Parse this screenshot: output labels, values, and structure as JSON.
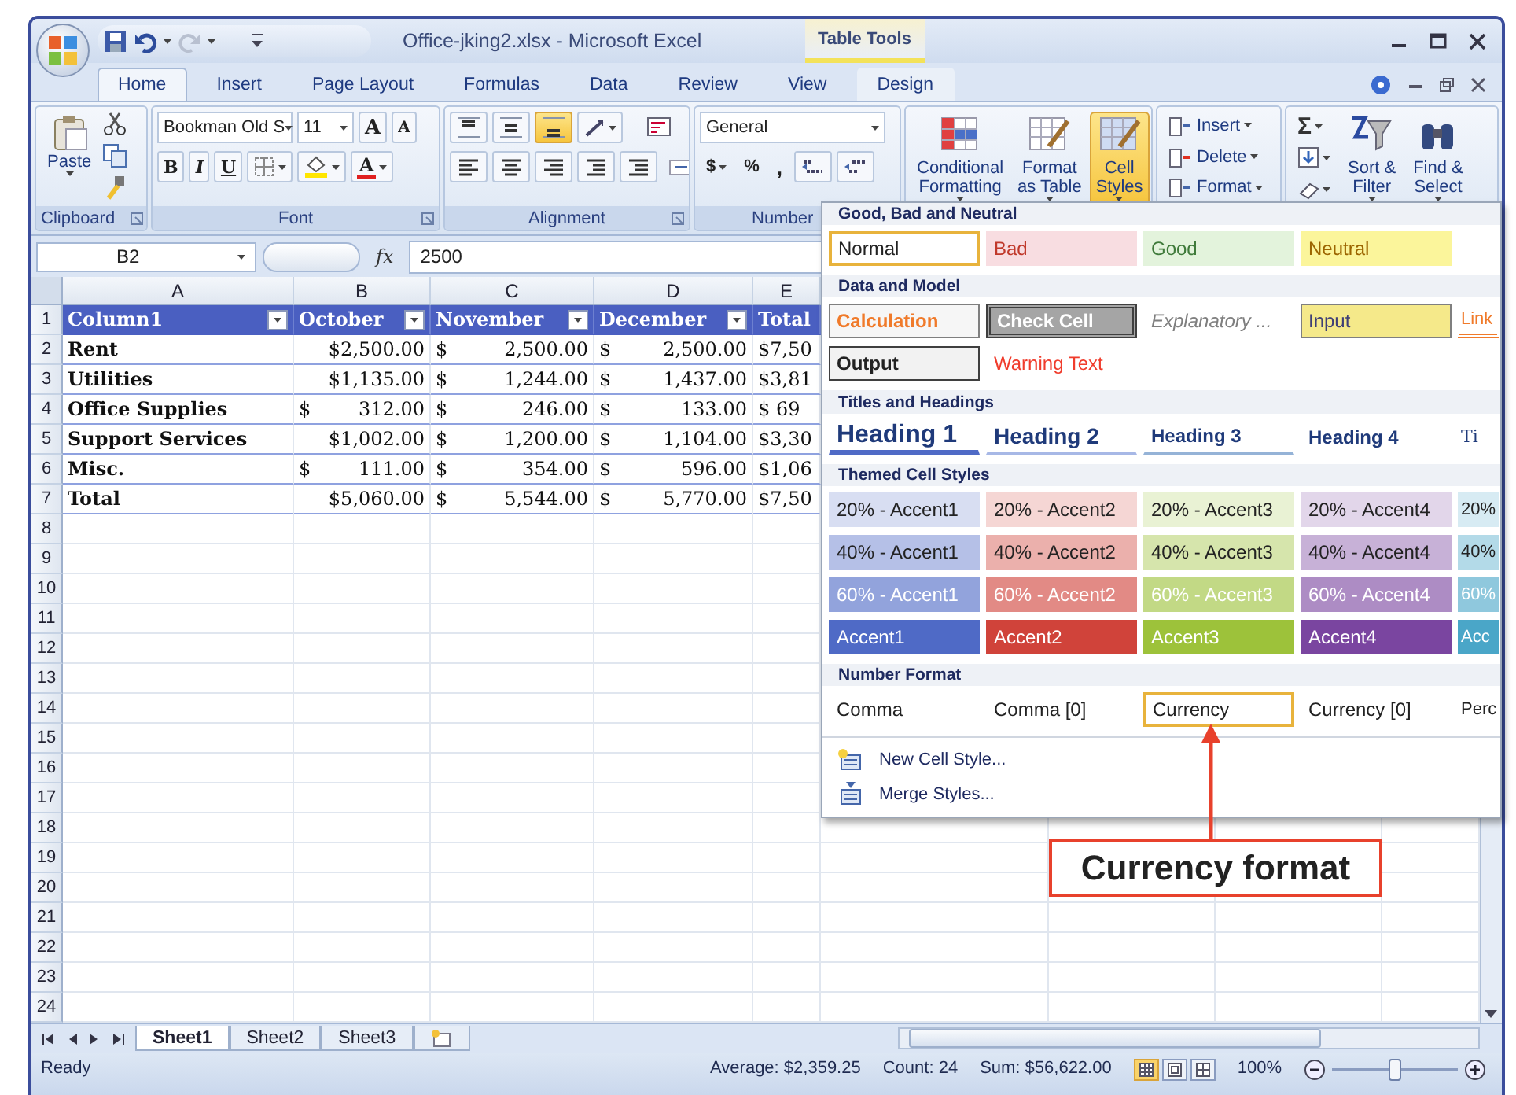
{
  "window": {
    "title": "Office-jking2.xlsx - Microsoft Excel",
    "contextual_title": "Table Tools"
  },
  "tabs": [
    {
      "label": "Home",
      "selected": true,
      "kind": "standard"
    },
    {
      "label": "Insert",
      "selected": false,
      "kind": "standard"
    },
    {
      "label": "Page Layout",
      "selected": false,
      "kind": "standard"
    },
    {
      "label": "Formulas",
      "selected": false,
      "kind": "standard"
    },
    {
      "label": "Data",
      "selected": false,
      "kind": "standard"
    },
    {
      "label": "Review",
      "selected": false,
      "kind": "standard"
    },
    {
      "label": "View",
      "selected": false,
      "kind": "standard"
    },
    {
      "label": "Design",
      "selected": false,
      "kind": "contextual"
    }
  ],
  "ribbon": {
    "clipboard": {
      "paste": "Paste",
      "label": "Clipboard"
    },
    "font": {
      "name": "Bookman Old S",
      "size": "11",
      "grow": "A",
      "shrink": "A",
      "bold": "B",
      "italic": "I",
      "underline": "U",
      "color_letter": "A",
      "label": "Font"
    },
    "alignment": {
      "vertical": [
        {
          "selected": false
        },
        {
          "selected": false
        },
        {
          "selected": true
        }
      ],
      "label": "Alignment"
    },
    "number": {
      "format": "General",
      "currency": "$",
      "percent": "%",
      "comma": ",",
      "label": "Number"
    },
    "styles": [
      {
        "lines": [
          "Conditional",
          "Formatting"
        ],
        "selected": false
      },
      {
        "lines": [
          "Format",
          "as Table"
        ],
        "selected": false
      },
      {
        "lines": [
          "Cell",
          "Styles"
        ],
        "selected": true
      }
    ],
    "cells": [
      "Insert",
      "Delete",
      "Format"
    ],
    "editing": {
      "sum": "Σ",
      "sort": [
        "Sort &",
        "Filter"
      ],
      "find": [
        "Find &",
        "Select"
      ]
    }
  },
  "formula_bar": {
    "name_box": "B2",
    "function": "fx",
    "value": "2500"
  },
  "sheet": {
    "columns": [
      "A",
      "B",
      "C",
      "D",
      "E"
    ],
    "rows": [
      {
        "number": "1",
        "kind": "header",
        "cells": [
          {
            "text": "Column1",
            "filter": true
          },
          {
            "text": "October",
            "filter": true
          },
          {
            "text": "November",
            "filter": true
          },
          {
            "text": "December",
            "filter": true
          },
          {
            "text": "Total",
            "filter": false
          }
        ]
      },
      {
        "number": "2",
        "kind": "data",
        "cells": [
          {
            "text": "Rent"
          },
          {
            "text": "$2,500.00"
          },
          {
            "symbol": "$",
            "amount": "2,500.00"
          },
          {
            "symbol": "$",
            "amount": "2,500.00"
          },
          {
            "text": "$7,50"
          }
        ]
      },
      {
        "number": "3",
        "kind": "data",
        "cells": [
          {
            "text": "Utilities"
          },
          {
            "text": "$1,135.00"
          },
          {
            "symbol": "$",
            "amount": "1,244.00"
          },
          {
            "symbol": "$",
            "amount": "1,437.00"
          },
          {
            "text": "$3,81"
          }
        ]
      },
      {
        "number": "4",
        "kind": "data",
        "cells": [
          {
            "text": "Office Supplies"
          },
          {
            "symbol": "$",
            "amount": "312.00"
          },
          {
            "symbol": "$",
            "amount": "246.00"
          },
          {
            "symbol": "$",
            "amount": "133.00"
          },
          {
            "text": "$ 69"
          }
        ]
      },
      {
        "number": "5",
        "kind": "data",
        "cells": [
          {
            "text": "Support Services"
          },
          {
            "text": "$1,002.00"
          },
          {
            "symbol": "$",
            "amount": "1,200.00"
          },
          {
            "symbol": "$",
            "amount": "1,104.00"
          },
          {
            "text": "$3,30"
          }
        ]
      },
      {
        "number": "6",
        "kind": "data",
        "cells": [
          {
            "text": "Misc."
          },
          {
            "symbol": "$",
            "amount": "111.00"
          },
          {
            "symbol": "$",
            "amount": "354.00"
          },
          {
            "symbol": "$",
            "amount": "596.00"
          },
          {
            "text": "$1,06"
          }
        ]
      },
      {
        "number": "7",
        "kind": "data",
        "cells": [
          {
            "text": "Total"
          },
          {
            "text": "$5,060.00"
          },
          {
            "symbol": "$",
            "amount": "5,544.00"
          },
          {
            "symbol": "$",
            "amount": "5,770.00"
          },
          {
            "text": "$7,50"
          }
        ]
      },
      {
        "number": "8"
      },
      {
        "number": "9"
      },
      {
        "number": "10"
      },
      {
        "number": "11"
      },
      {
        "number": "12"
      },
      {
        "number": "13"
      },
      {
        "number": "14"
      },
      {
        "number": "15"
      },
      {
        "number": "16"
      },
      {
        "number": "17"
      },
      {
        "number": "18"
      },
      {
        "number": "19"
      },
      {
        "number": "20"
      },
      {
        "number": "21"
      },
      {
        "number": "22"
      },
      {
        "number": "23"
      },
      {
        "number": "24"
      }
    ]
  },
  "gallery": {
    "sections": [
      {
        "title": "Good, Bad and Neutral",
        "items": [
          {
            "label": "Normal",
            "kind": "normal",
            "selected": true
          },
          {
            "label": "Bad",
            "kind": "bad",
            "selected": false
          },
          {
            "label": "Good",
            "kind": "good",
            "selected": false
          },
          {
            "label": "Neutral",
            "kind": "neutral",
            "selected": false
          }
        ]
      },
      {
        "title": "Data and Model",
        "items": [
          {
            "label": "Calculation",
            "kind": "calculation",
            "selected": false
          },
          {
            "label": "Check Cell",
            "kind": "check",
            "selected": false
          },
          {
            "label": "Explanatory ...",
            "kind": "explanatory",
            "selected": false
          },
          {
            "label": "Input",
            "kind": "input",
            "selected": false
          },
          {
            "label": "Link",
            "kind": "link",
            "selected": false
          },
          {
            "label": "Output",
            "kind": "output",
            "selected": false
          },
          {
            "label": "Warning Text",
            "kind": "warning",
            "selected": false
          }
        ]
      },
      {
        "title": "Titles and Headings",
        "items": [
          {
            "label": "Heading 1",
            "kind": "heading1",
            "selected": false
          },
          {
            "label": "Heading 2",
            "kind": "heading2",
            "selected": false
          },
          {
            "label": "Heading 3",
            "kind": "heading3",
            "selected": false
          },
          {
            "label": "Heading 4",
            "kind": "heading4",
            "selected": false
          },
          {
            "label": "Ti",
            "kind": "title",
            "selected": false
          }
        ]
      },
      {
        "title": "Themed Cell Styles",
        "items": [
          {
            "label": "20% - Accent1",
            "kind": "accent20",
            "selected": false
          },
          {
            "label": "20% - Accent2",
            "kind": "accent20",
            "selected": false
          },
          {
            "label": "20% - Accent3",
            "kind": "accent20",
            "selected": false
          },
          {
            "label": "20% - Accent4",
            "kind": "accent20",
            "selected": false
          },
          {
            "label": "20%",
            "kind": "accent20",
            "selected": false
          },
          {
            "label": "40% - Accent1",
            "kind": "accent40",
            "selected": false
          },
          {
            "label": "40% - Accent2",
            "kind": "accent40",
            "selected": false
          },
          {
            "label": "40% - Accent3",
            "kind": "accent40",
            "selected": false
          },
          {
            "label": "40% - Accent4",
            "kind": "accent40",
            "selected": false
          },
          {
            "label": "40%",
            "kind": "accent40",
            "selected": false
          },
          {
            "label": "60% - Accent1",
            "kind": "accent60",
            "selected": false
          },
          {
            "label": "60% - Accent2",
            "kind": "accent60",
            "selected": false
          },
          {
            "label": "60% - Accent3",
            "kind": "accent60",
            "selected": false
          },
          {
            "label": "60% - Accent4",
            "kind": "accent60",
            "selected": false
          },
          {
            "label": "60%",
            "kind": "accent60",
            "selected": false
          },
          {
            "label": "Accent1",
            "kind": "accent",
            "color": "#4f6ac6",
            "selected": false
          },
          {
            "label": "Accent2",
            "kind": "accent",
            "color": "#d0433a",
            "selected": false
          },
          {
            "label": "Accent3",
            "kind": "accent",
            "color": "#9dc23a",
            "selected": false
          },
          {
            "label": "Accent4",
            "kind": "accent",
            "color": "#7a45a0",
            "selected": false
          },
          {
            "label": "Acc",
            "kind": "accent",
            "color": "#4aa6c8",
            "selected": false
          }
        ]
      },
      {
        "title": "Number Format",
        "items": [
          {
            "label": "Comma",
            "kind": "number",
            "selected": false
          },
          {
            "label": "Comma [0]",
            "kind": "number",
            "selected": false
          },
          {
            "label": "Currency",
            "kind": "number",
            "selected": true
          },
          {
            "label": "Currency [0]",
            "kind": "number",
            "selected": false
          },
          {
            "label": "Perc",
            "kind": "number",
            "selected": false
          }
        ]
      }
    ],
    "commands": [
      "New Cell Style...",
      "Merge Styles..."
    ]
  },
  "callout": "Currency format",
  "sheet_tabs": [
    {
      "label": "Sheet1",
      "selected": true
    },
    {
      "label": "Sheet2",
      "selected": false
    },
    {
      "label": "Sheet3",
      "selected": false
    }
  ],
  "status_bar": {
    "mode": "Ready",
    "average": "Average: $2,359.25",
    "count": "Count: 24",
    "sum": "Sum: $56,622.00",
    "views": [
      {
        "selected": true
      },
      {
        "selected": false
      },
      {
        "selected": false
      }
    ],
    "zoom": "100%",
    "level": 0.5
  }
}
